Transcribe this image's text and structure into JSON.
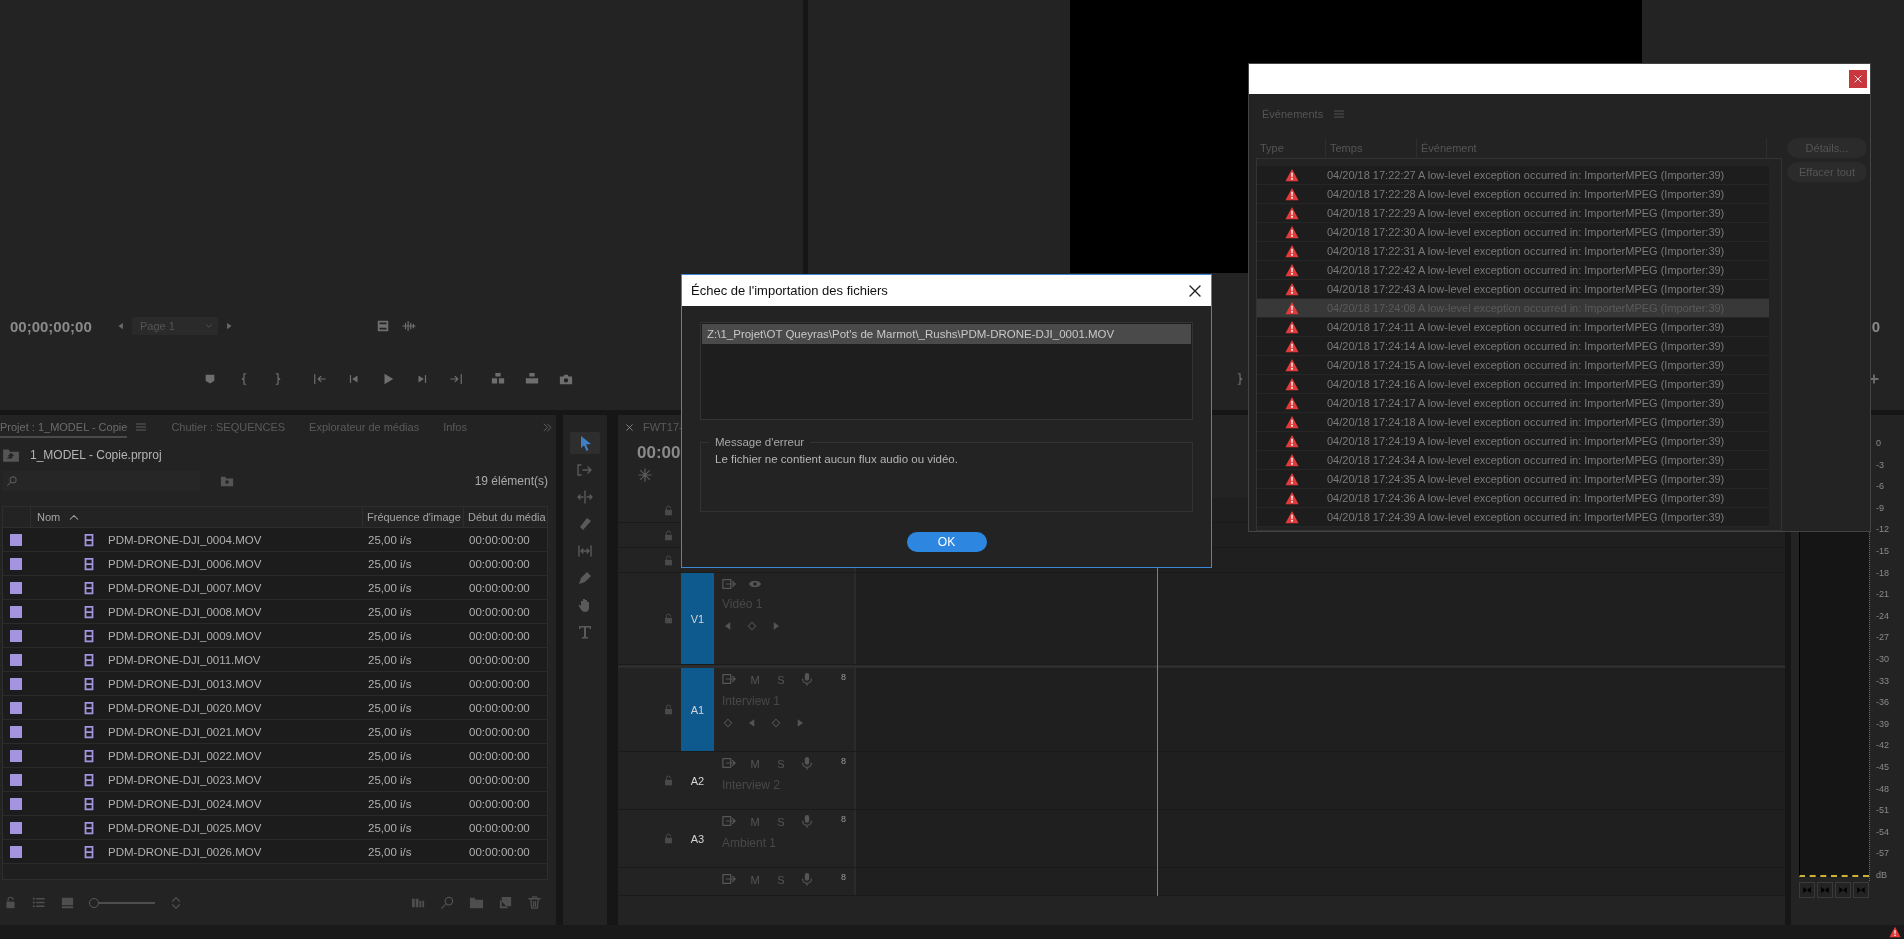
{
  "source_monitor": {
    "timecode": "00;00;00;00",
    "page": "Page 1"
  },
  "program_monitor": {
    "timecode": "0"
  },
  "project_panel": {
    "tabs": [
      {
        "label": "Projet : 1_MODEL - Copie",
        "selected": true
      },
      {
        "label": "Chutier : SEQUENCES",
        "selected": false
      },
      {
        "label": "Explorateur de médias",
        "selected": false
      },
      {
        "label": "Infos",
        "selected": false
      }
    ],
    "project_file": "1_MODEL - Copie.prproj",
    "item_count": "19 élément(s)",
    "columns": [
      "Nom",
      "Fréquence d'image",
      "Début du média"
    ],
    "rows": [
      {
        "name": "PDM-DRONE-DJI_0004.MOV",
        "frame_rate": "25,00 i/s",
        "media_start": "00:00:00:00"
      },
      {
        "name": "PDM-DRONE-DJI_0006.MOV",
        "frame_rate": "25,00 i/s",
        "media_start": "00:00:00:00"
      },
      {
        "name": "PDM-DRONE-DJI_0007.MOV",
        "frame_rate": "25,00 i/s",
        "media_start": "00:00:00:00"
      },
      {
        "name": "PDM-DRONE-DJI_0008.MOV",
        "frame_rate": "25,00 i/s",
        "media_start": "00:00:00:00"
      },
      {
        "name": "PDM-DRONE-DJI_0009.MOV",
        "frame_rate": "25,00 i/s",
        "media_start": "00:00:00:00"
      },
      {
        "name": "PDM-DRONE-DJI_0011.MOV",
        "frame_rate": "25,00 i/s",
        "media_start": "00:00:00:00"
      },
      {
        "name": "PDM-DRONE-DJI_0013.MOV",
        "frame_rate": "25,00 i/s",
        "media_start": "00:00:00:00"
      },
      {
        "name": "PDM-DRONE-DJI_0020.MOV",
        "frame_rate": "25,00 i/s",
        "media_start": "00:00:00:00"
      },
      {
        "name": "PDM-DRONE-DJI_0021.MOV",
        "frame_rate": "25,00 i/s",
        "media_start": "00:00:00:00"
      },
      {
        "name": "PDM-DRONE-DJI_0022.MOV",
        "frame_rate": "25,00 i/s",
        "media_start": "00:00:00:00"
      },
      {
        "name": "PDM-DRONE-DJI_0023.MOV",
        "frame_rate": "25,00 i/s",
        "media_start": "00:00:00:00"
      },
      {
        "name": "PDM-DRONE-DJI_0024.MOV",
        "frame_rate": "25,00 i/s",
        "media_start": "00:00:00:00"
      },
      {
        "name": "PDM-DRONE-DJI_0025.MOV",
        "frame_rate": "25,00 i/s",
        "media_start": "00:00:00:00"
      },
      {
        "name": "PDM-DRONE-DJI_0026.MOV",
        "frame_rate": "25,00 i/s",
        "media_start": "00:00:00:00"
      }
    ],
    "zoom_slider": {
      "level": 0
    }
  },
  "tools": [
    {
      "kind": "selection",
      "selected": true
    },
    {
      "kind": "track-select",
      "selected": false
    },
    {
      "kind": "ripple",
      "selected": false
    },
    {
      "kind": "razor",
      "selected": false
    },
    {
      "kind": "slip",
      "selected": false
    },
    {
      "kind": "pen",
      "selected": false
    },
    {
      "kind": "hand",
      "selected": false
    },
    {
      "kind": "type",
      "selected": false
    }
  ],
  "timeline": {
    "tab": "FWT17-",
    "timecode": "00:00",
    "tracks": [
      {
        "kind": "collapsed"
      },
      {
        "kind": "collapsed"
      },
      {
        "kind": "collapsed"
      },
      {
        "kind": "video",
        "label": "V1",
        "name": "Vidéo 1",
        "targeted": true,
        "expanded": true
      },
      {
        "kind": "audio",
        "label": "A1",
        "name": "Interview 1",
        "mute": "M",
        "solo": "S",
        "channels": "8",
        "targeted": true,
        "expanded": true
      },
      {
        "kind": "audio",
        "label": "A2",
        "name": "Interview 2",
        "mute": "M",
        "solo": "S",
        "channels": "8",
        "targeted": false,
        "expanded": false
      },
      {
        "kind": "audio",
        "label": "A3",
        "name": "Ambient 1",
        "mute": "M",
        "solo": "S",
        "channels": "8",
        "targeted": false,
        "expanded": false
      },
      {
        "kind": "audio",
        "mute": "M",
        "solo": "S",
        "channels": "8",
        "expanded": false
      }
    ]
  },
  "audio_meter": {
    "scale": [
      "0",
      "-3",
      "-6",
      "-9",
      "-12",
      "-15",
      "-18",
      "-21",
      "-24",
      "-27",
      "-30",
      "-33",
      "-36",
      "-39",
      "-42",
      "-45",
      "-48",
      "-51",
      "-54",
      "-57",
      "dB"
    ]
  },
  "import_error_dialog": {
    "title": "Échec de l'importation des fichiers",
    "files": [
      {
        "path": "Z:\\1_Projet\\OT Queyras\\Pot's de Marmot\\_Rushs\\PDM-DRONE-DJI_0001.MOV",
        "selected": true
      }
    ],
    "message_label": "Message d'erreur",
    "message": "Le fichier ne contient aucun flux audio ou vidéo.",
    "ok_button": "OK"
  },
  "events_window": {
    "title": "Événements",
    "columns": [
      "Type",
      "Temps",
      "Événement"
    ],
    "rows": [
      {
        "kind": "warning",
        "time": "04/20/18 17:22:27",
        "event": "A low-level exception occurred in: ImporterMPEG (Importer:39)",
        "selected": false
      },
      {
        "kind": "warning",
        "time": "04/20/18 17:22:28",
        "event": "A low-level exception occurred in: ImporterMPEG (Importer:39)",
        "selected": false
      },
      {
        "kind": "warning",
        "time": "04/20/18 17:22:29",
        "event": "A low-level exception occurred in: ImporterMPEG (Importer:39)",
        "selected": false
      },
      {
        "kind": "warning",
        "time": "04/20/18 17:22:30",
        "event": "A low-level exception occurred in: ImporterMPEG (Importer:39)",
        "selected": false
      },
      {
        "kind": "warning",
        "time": "04/20/18 17:22:31",
        "event": "A low-level exception occurred in: ImporterMPEG (Importer:39)",
        "selected": false
      },
      {
        "kind": "warning",
        "time": "04/20/18 17:22:42",
        "event": "A low-level exception occurred in: ImporterMPEG (Importer:39)",
        "selected": false
      },
      {
        "kind": "warning",
        "time": "04/20/18 17:22:43",
        "event": "A low-level exception occurred in: ImporterMPEG (Importer:39)",
        "selected": false
      },
      {
        "kind": "warning",
        "time": "04/20/18 17:24:08",
        "event": "A low-level exception occurred in: ImporterMPEG (Importer:39)",
        "selected": true
      },
      {
        "kind": "warning",
        "time": "04/20/18 17:24:11",
        "event": "A low-level exception occurred in: ImporterMPEG (Importer:39)",
        "selected": false
      },
      {
        "kind": "warning",
        "time": "04/20/18 17:24:14",
        "event": "A low-level exception occurred in: ImporterMPEG (Importer:39)",
        "selected": false
      },
      {
        "kind": "warning",
        "time": "04/20/18 17:24:15",
        "event": "A low-level exception occurred in: ImporterMPEG (Importer:39)",
        "selected": false
      },
      {
        "kind": "warning",
        "time": "04/20/18 17:24:16",
        "event": "A low-level exception occurred in: ImporterMPEG (Importer:39)",
        "selected": false
      },
      {
        "kind": "warning",
        "time": "04/20/18 17:24:17",
        "event": "A low-level exception occurred in: ImporterMPEG (Importer:39)",
        "selected": false
      },
      {
        "kind": "warning",
        "time": "04/20/18 17:24:18",
        "event": "A low-level exception occurred in: ImporterMPEG (Importer:39)",
        "selected": false
      },
      {
        "kind": "warning",
        "time": "04/20/18 17:24:19",
        "event": "A low-level exception occurred in: ImporterMPEG (Importer:39)",
        "selected": false
      },
      {
        "kind": "warning",
        "time": "04/20/18 17:24:34",
        "event": "A low-level exception occurred in: ImporterMPEG (Importer:39)",
        "selected": false
      },
      {
        "kind": "warning",
        "time": "04/20/18 17:24:35",
        "event": "A low-level exception occurred in: ImporterMPEG (Importer:39)",
        "selected": false
      },
      {
        "kind": "warning",
        "time": "04/20/18 17:24:36",
        "event": "A low-level exception occurred in: ImporterMPEG (Importer:39)",
        "selected": false
      },
      {
        "kind": "warning",
        "time": "04/20/18 17:24:39",
        "event": "A low-level exception occurred in: ImporterMPEG (Importer:39)",
        "selected": false
      }
    ],
    "buttons": [
      {
        "label": "Détails...",
        "disabled": true
      },
      {
        "label": "Effacer tout",
        "disabled": true
      }
    ]
  }
}
